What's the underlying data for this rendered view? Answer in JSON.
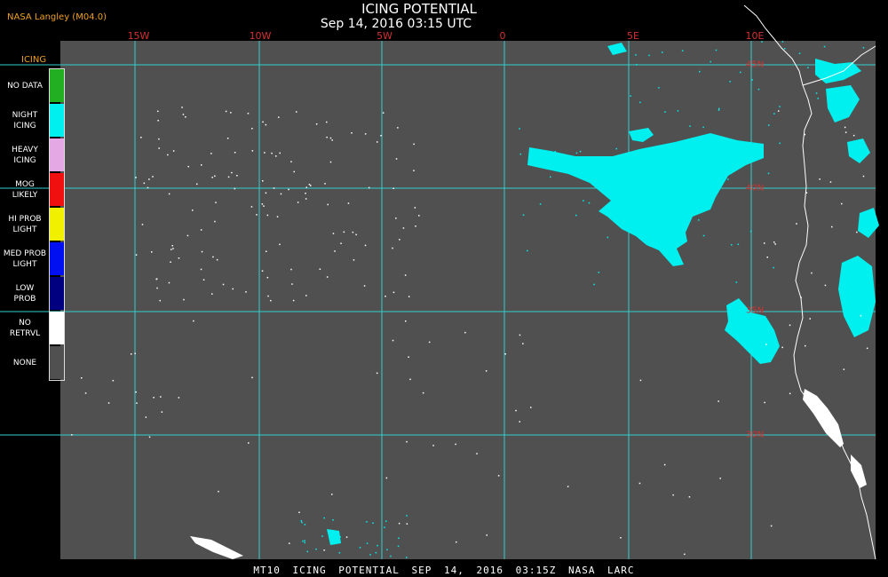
{
  "header": {
    "source": "NASA Langley (M04.0)",
    "title": "ICING POTENTIAL",
    "time": "Sep 14, 2016 03:15 UTC"
  },
  "longitude_labels": [
    "15W",
    "10W",
    "5W",
    "0",
    "5E",
    "10E"
  ],
  "latitude_labels": [
    "45N",
    "40N",
    "35N",
    "30N"
  ],
  "legend": {
    "title": "ICING",
    "items": [
      {
        "label": "NO DATA",
        "color": "#22b022"
      },
      {
        "label": "NIGHT\nICING",
        "color": "#00f0f0"
      },
      {
        "label": "HEAVY\nICING",
        "color": "#e4a8e4"
      },
      {
        "label": "MOG\nLIKELY",
        "color": "#f01010"
      },
      {
        "label": "HI PROB\nLIGHT",
        "color": "#f0f000"
      },
      {
        "label": "MED PROB\nLIGHT",
        "color": "#0010f0"
      },
      {
        "label": "LOW\nPROB",
        "color": "#000080"
      },
      {
        "label": "NO\nRETRVL",
        "color": "#ffffff"
      },
      {
        "label": "NONE",
        "color": "#505050"
      }
    ]
  },
  "colors": {
    "background": "#505050",
    "grid": "#30d0d0",
    "icing": "#00f0f0",
    "coast": "#ffffff"
  },
  "footer": {
    "caption": "MT10 ICING POTENTIAL SEP 14, 2016 03:15Z NASA LARC"
  }
}
